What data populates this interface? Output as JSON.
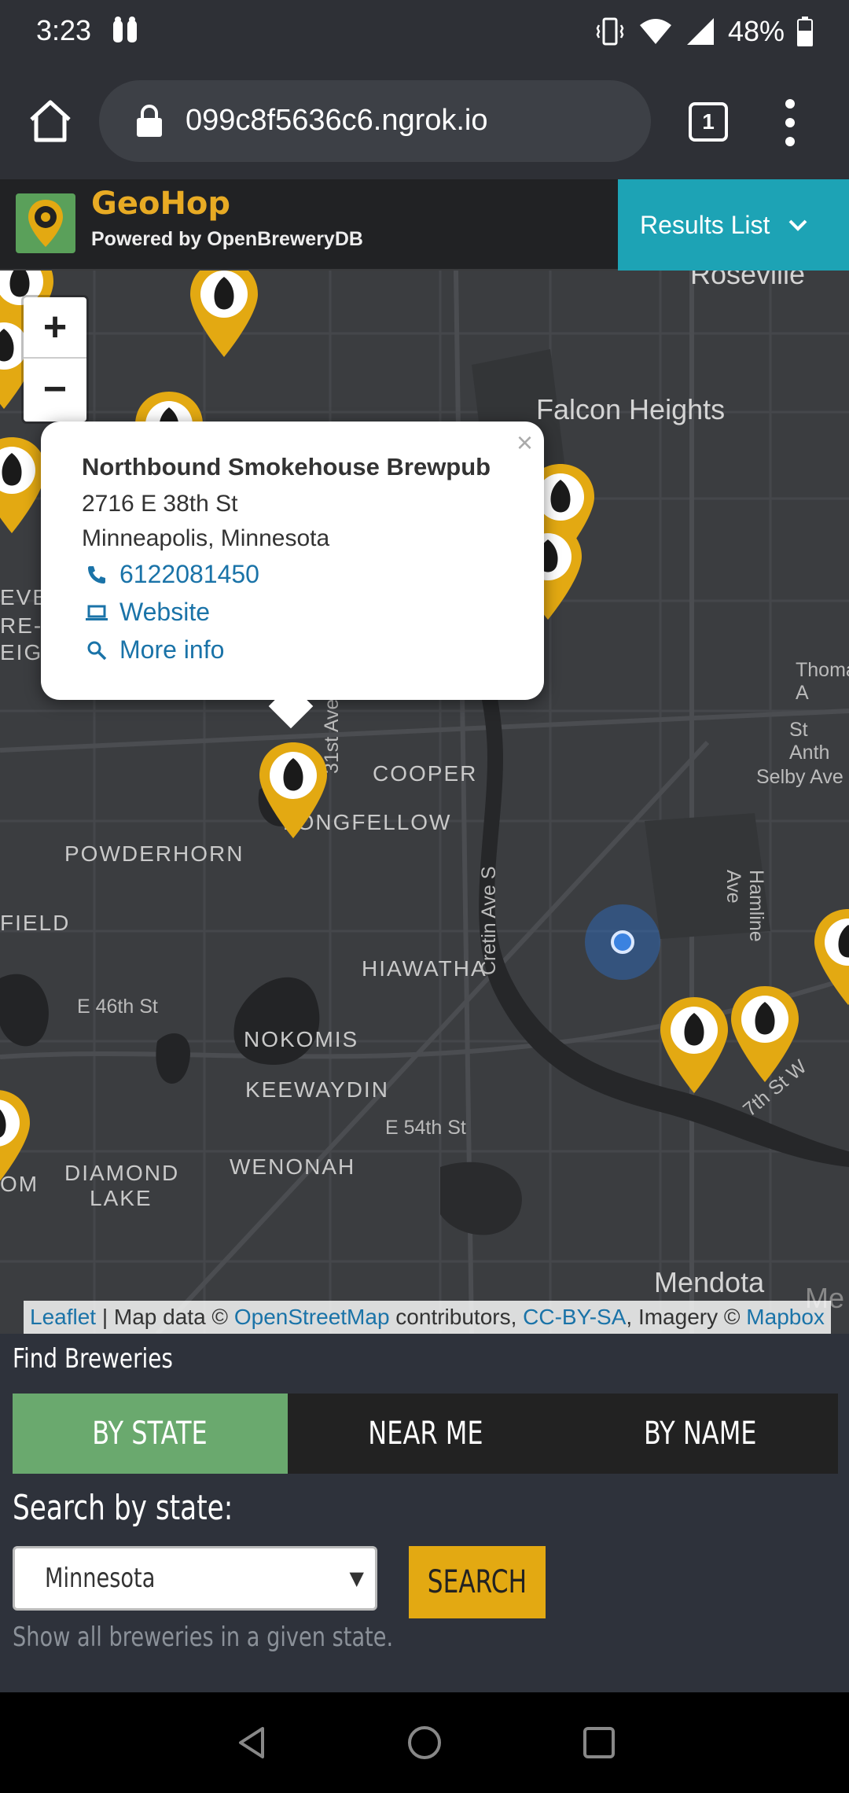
{
  "status": {
    "time": "3:23",
    "battery": "48%"
  },
  "browser": {
    "url": "099c8f5636c6.ngrok.io",
    "tab_count": "1"
  },
  "app": {
    "title": "GeoHop",
    "subtitle": "Powered by OpenBreweryDB",
    "results_button": "Results List"
  },
  "map": {
    "zoom_in": "+",
    "zoom_out": "−",
    "labels": {
      "roseville": "Roseville",
      "falcon_heights": "Falcon Heights",
      "thomas": "Thomas A",
      "st_anth": "St Anth",
      "selby": "Selby Ave",
      "cooper": "COOPER",
      "longfellow": "LONGFELLOW",
      "powderhorn": "POWDERHORN",
      "field": "FIELD",
      "hiawatha": "HIAWATHA",
      "e46th": "E 46th St",
      "nokomis": "NOKOMIS",
      "keewaydin": "KEEWAYDIN",
      "e54th": "E 54th St",
      "diamond": "DIAMOND",
      "lake": "LAKE",
      "wenonah": "WENONAH",
      "mendota": "Mendota",
      "me": "Me",
      "cretin": "Cretin Ave S",
      "hamline": "Hamline Ave",
      "st31": "31st Ave S",
      "st7": "7th St W",
      "om": "OM",
      "eve": "EVE",
      "re": "RE-L",
      "eigh": "EIGH"
    },
    "popup": {
      "close": "×",
      "name": "Northbound Smokehouse Brewpub",
      "street": "2716 E 38th St",
      "city": "Minneapolis, Minnesota",
      "phone": "6122081450",
      "website": "Website",
      "more_info": "More info"
    },
    "attribution": {
      "leaflet": "Leaflet",
      "sep1": " | Map data © ",
      "osm": "OpenStreetMap",
      "contrib": " contributors, ",
      "license": "CC-BY-SA",
      "imagery": ", Imagery © ",
      "mapbox": "Mapbox"
    }
  },
  "finder": {
    "title": "Find Breweries",
    "tabs": [
      "BY STATE",
      "NEAR ME",
      "BY NAME"
    ],
    "active_tab": 0,
    "search_label": "Search by state:",
    "selected_state": "Minnesota",
    "search_button": "SEARCH",
    "help_text": "Show all breweries in a given state."
  },
  "colors": {
    "accent_teal": "#1da3b5",
    "pin_gold": "#e3a912",
    "active_tab_green": "#6aa96e",
    "title_gold": "#e8ab24"
  }
}
